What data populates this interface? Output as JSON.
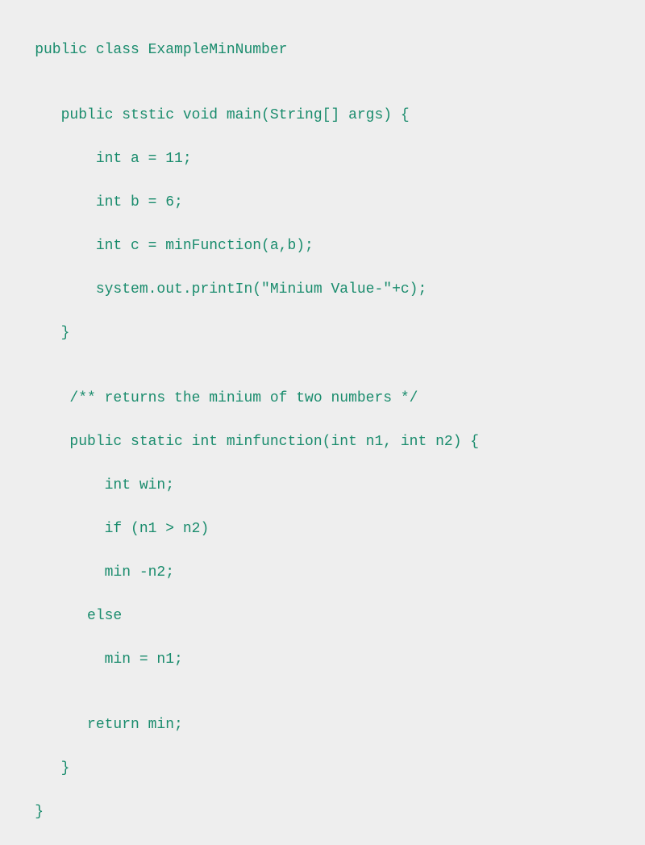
{
  "code": {
    "line1": "    public class ExampleMinNumber",
    "line2": "",
    "line3": "       public ststic void main(String[] args) {",
    "line4": "           int a = 11;",
    "line5": "           int b = 6;",
    "line6": "           int c = minFunction(a,b);",
    "line7": "           system.out.printIn(\"Minium Value-\"+c);",
    "line8": "       }",
    "line9": "",
    "line10": "        /** returns the minium of two numbers */",
    "line11": "        public static int minfunction(int n1, int n2) {",
    "line12": "            int win;",
    "line13": "            if (n1 > n2)",
    "line14": "            min -n2;",
    "line15": "          else",
    "line16": "            min = n1;",
    "line17": "",
    "line18": "          return min;",
    "line19": "       }",
    "line20": "    }"
  }
}
